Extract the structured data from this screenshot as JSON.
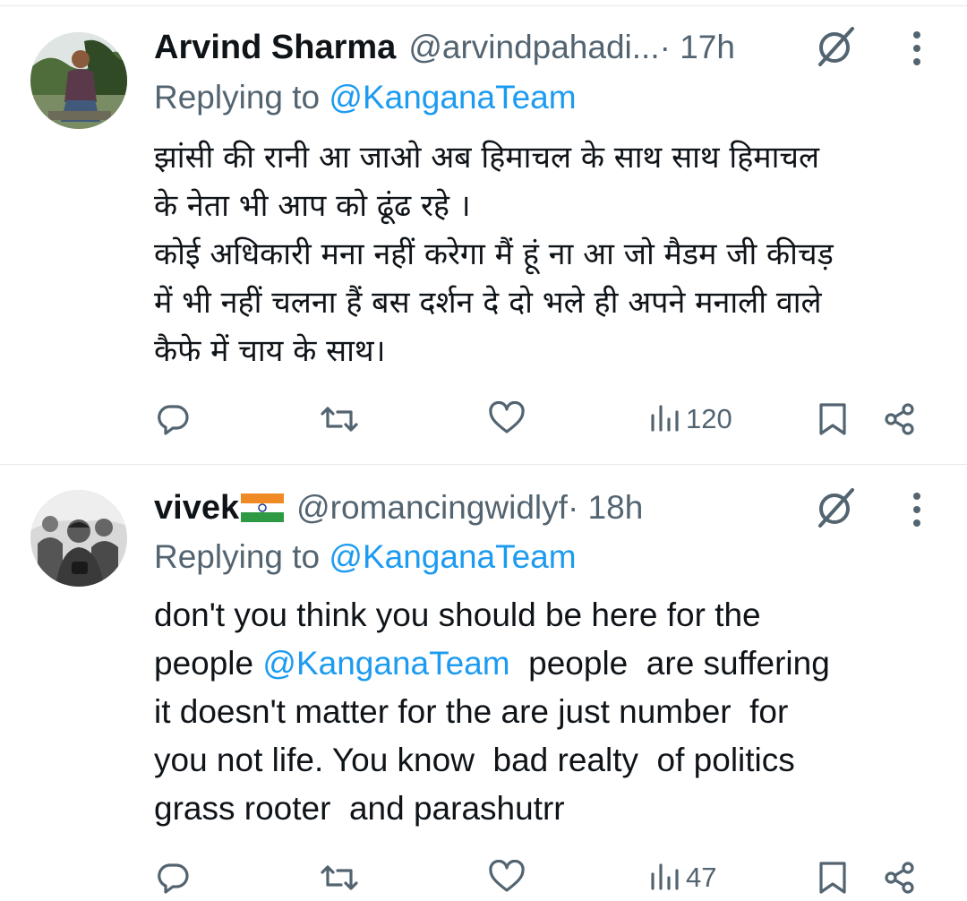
{
  "tweets": [
    {
      "name": "Arvind Sharma",
      "handle": "@arvindpahadi...",
      "time_sep": " · 17h",
      "replying_prefix": "Replying to ",
      "replying_to": "@KanganaTeam",
      "lines": [
        "झांसी की रानी आ जाओ अब हिमाचल के साथ साथ हिमाचल",
        "के नेता भी आप को ढूंढ रहे ।",
        "कोई अधिकारी मना नहीं करेगा मैं हूं ना आ जो मैडम जी कीचड़",
        "में भी नहीं चलना हैं बस दर्शन दे दो भले ही अपने मनाली वाले",
        "कैफे में चाय के साथ।"
      ],
      "views": "120"
    },
    {
      "name": "vivek",
      "handle": "@romancingwidlyf",
      "time_sep": " · 18h",
      "replying_prefix": "Replying to ",
      "replying_to": "@KanganaTeam",
      "line1": "don't you think you should be here for the",
      "line2_pre": "people ",
      "line2_mention": "@KanganaTeam",
      "line2_post": "  people  are suffering",
      "line3": "it doesn't matter for the are just number  for",
      "line4": "you not life. You know  bad realty  of politics",
      "line5": "grass rooter  and parashutrr",
      "views": "47"
    }
  ],
  "icons": {
    "reply": "reply-icon",
    "repost": "repost-icon",
    "like": "like-icon",
    "views": "views-icon",
    "bookmark": "bookmark-icon",
    "share": "share-icon",
    "grok": "grok-icon",
    "more": "more-icon",
    "flag": "india-flag-emoji"
  },
  "colors": {
    "text": "#0f1419",
    "secondary": "#536471",
    "link": "#1d9bf0",
    "divider": "#e6e8eb"
  }
}
